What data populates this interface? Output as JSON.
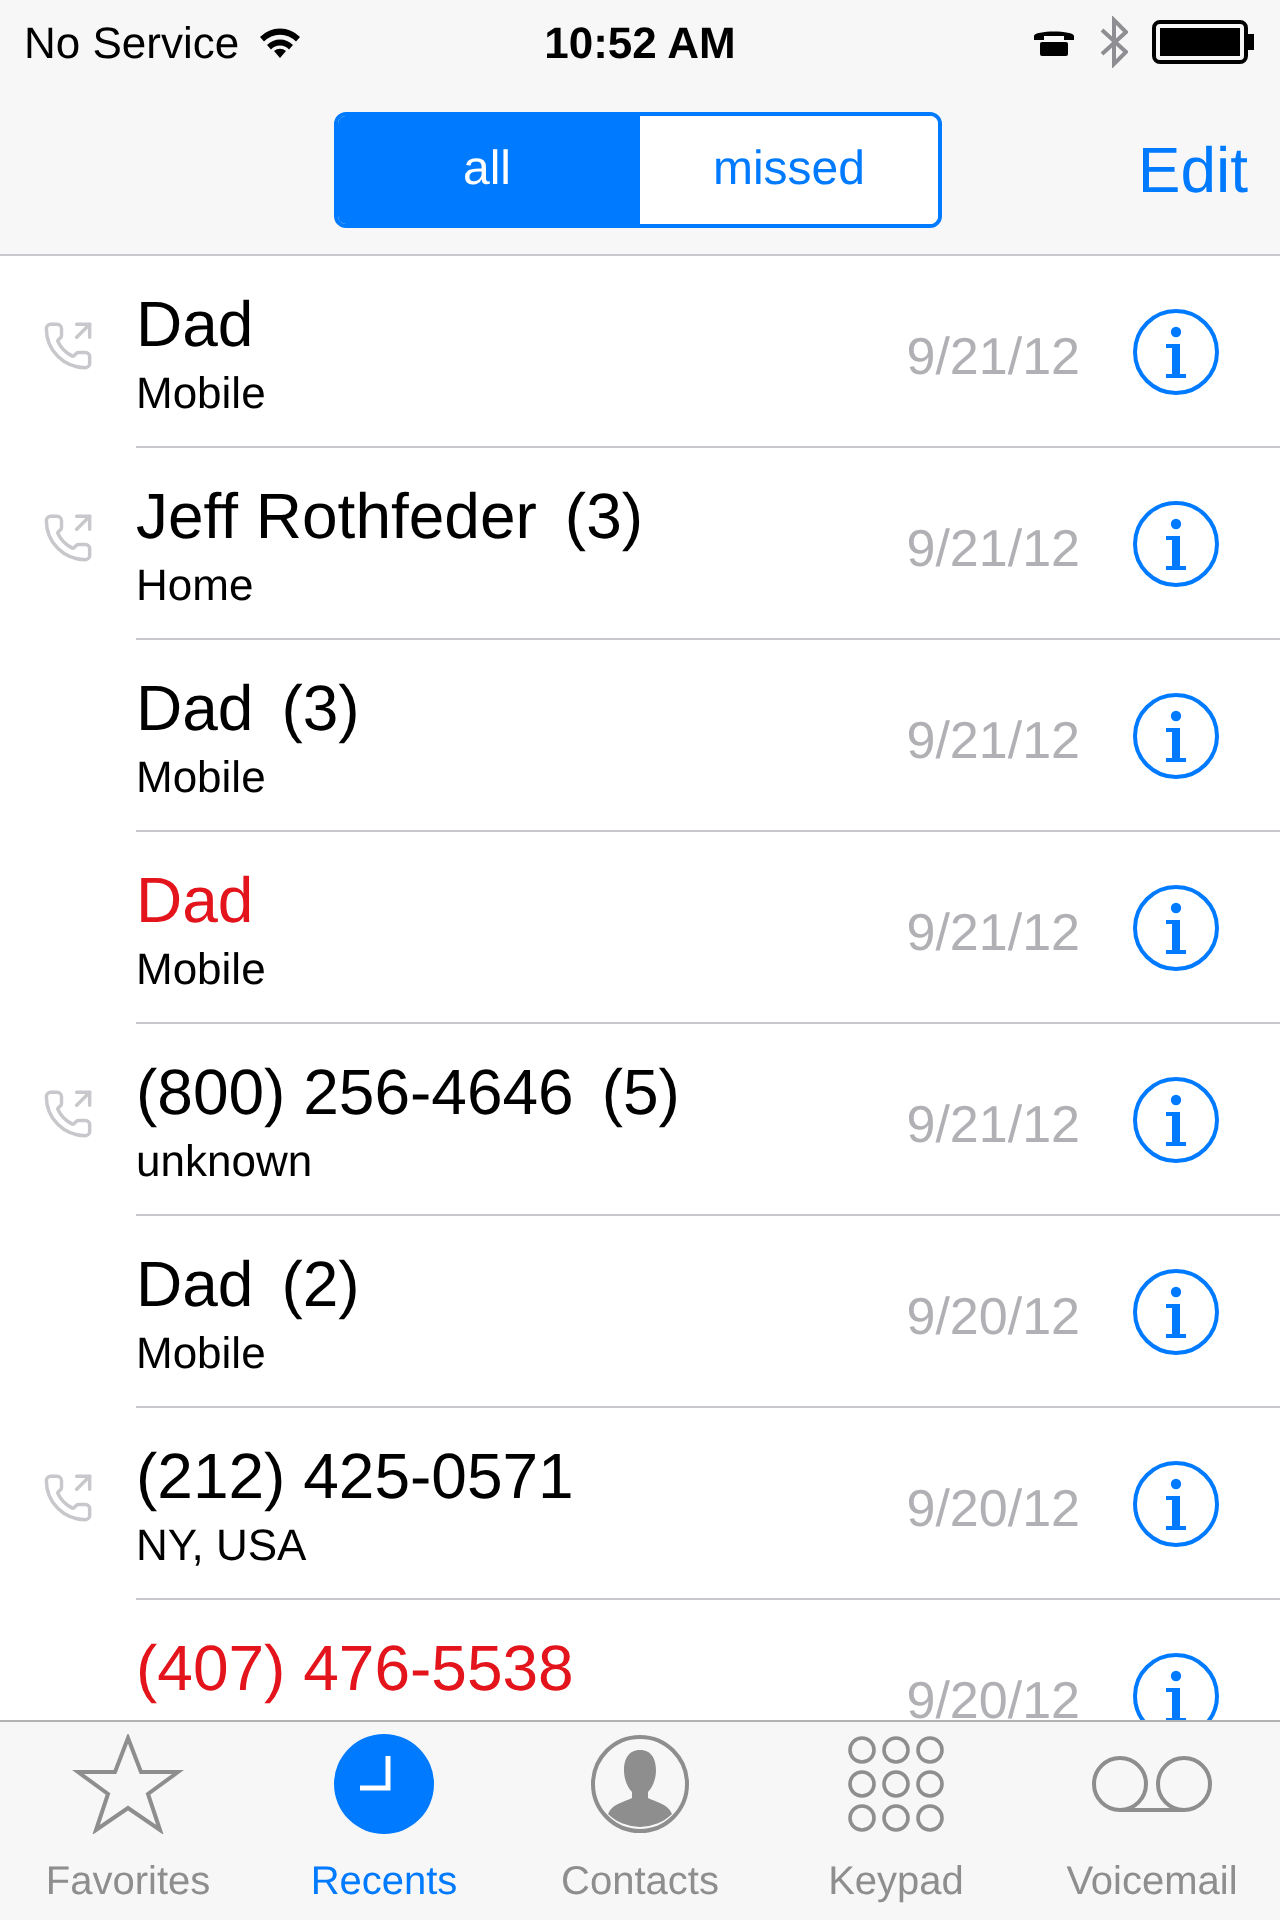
{
  "status_bar": {
    "carrier": "No Service",
    "time": "10:52 AM"
  },
  "segments": [
    {
      "label": "all",
      "selected": true
    },
    {
      "label": "missed",
      "selected": false
    }
  ],
  "edit": "Edit",
  "calls": [
    {
      "name": "Dad",
      "type": "Mobile",
      "date": "9/21/12",
      "missed": false,
      "outgoing": true
    },
    {
      "name": "Jeff Rothfeder",
      "count": "(3)",
      "type": "Home",
      "date": "9/21/12",
      "missed": false,
      "outgoing": true
    },
    {
      "name": "Dad",
      "count": "(3)",
      "type": "Mobile",
      "date": "9/21/12",
      "missed": false,
      "outgoing": false
    },
    {
      "name": "Dad",
      "type": "Mobile",
      "date": "9/21/12",
      "missed": true,
      "outgoing": false
    },
    {
      "name": "(800) 256-4646",
      "count": "(5)",
      "type": "unknown",
      "date": "9/21/12",
      "missed": false,
      "outgoing": true
    },
    {
      "name": "Dad",
      "count": "(2)",
      "type": "Mobile",
      "date": "9/20/12",
      "missed": false,
      "outgoing": false
    },
    {
      "name": "(212) 425-0571",
      "type": "NY, USA",
      "date": "9/20/12",
      "missed": false,
      "outgoing": true
    },
    {
      "name": "(407) 476-5538",
      "date": "9/20/12",
      "missed": true,
      "outgoing": false
    }
  ],
  "tab_bar": [
    {
      "label": "Favorites",
      "kind": "star",
      "selected": false
    },
    {
      "label": "Recents",
      "kind": "clock",
      "selected": true
    },
    {
      "label": "Contacts",
      "kind": "person",
      "selected": false
    },
    {
      "label": "Keypad",
      "kind": "keypad",
      "selected": false
    },
    {
      "label": "Voicemail",
      "kind": "voicemail",
      "selected": false
    }
  ]
}
